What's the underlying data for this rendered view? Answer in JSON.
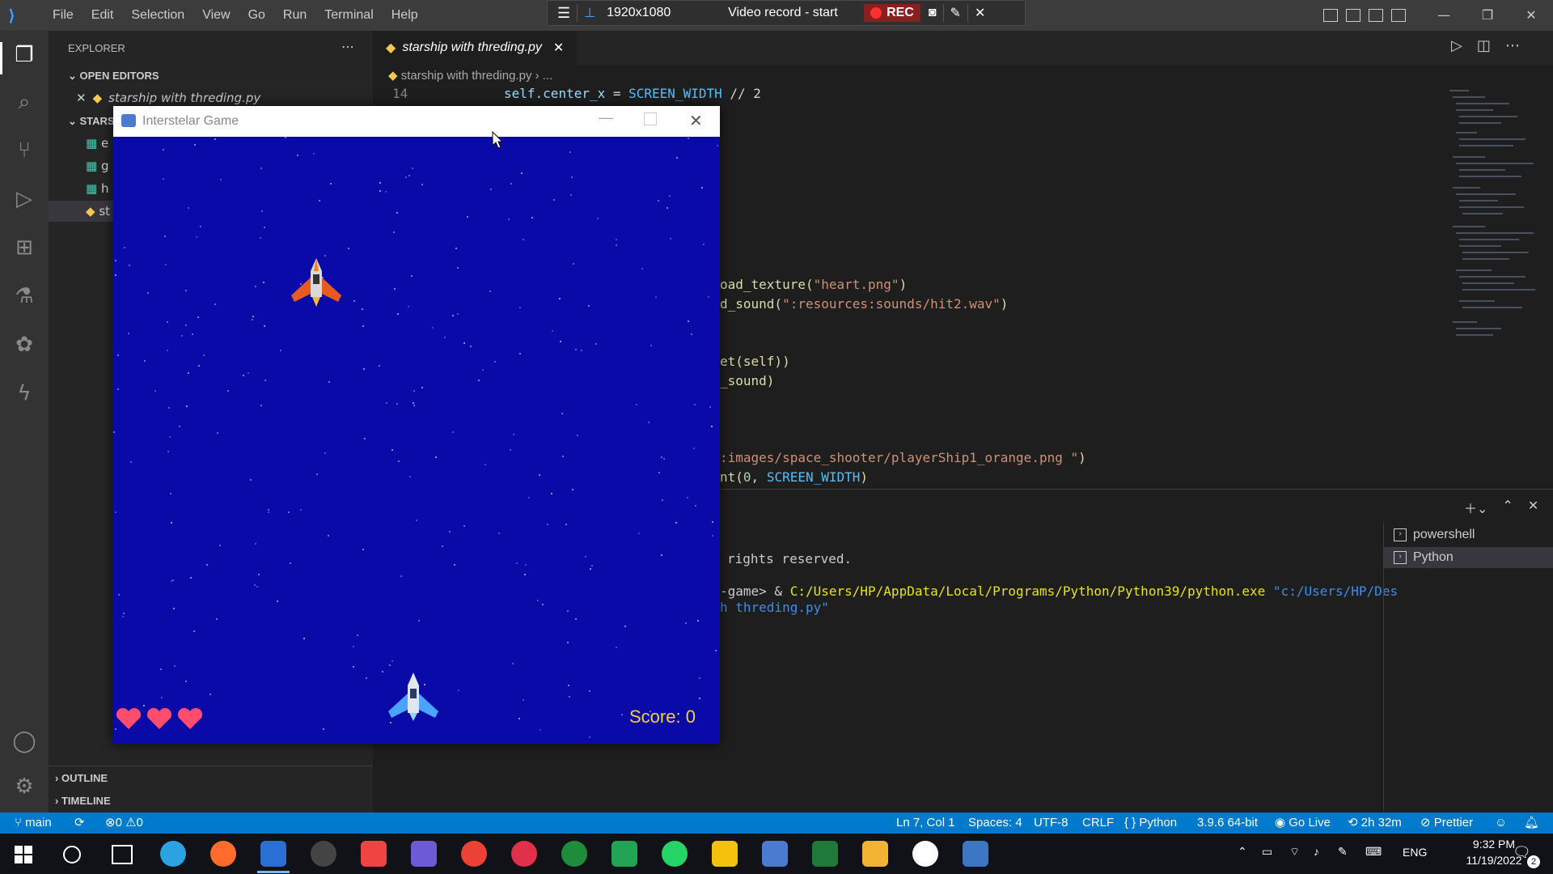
{
  "app": {
    "menu": [
      "File",
      "Edit",
      "Selection",
      "View",
      "Go",
      "Run",
      "Terminal",
      "Help"
    ],
    "window_controls": [
      "—",
      "❐",
      "✕"
    ]
  },
  "recorder": {
    "resolution": "1920x1080",
    "status": "Video record - start",
    "rec_label": "REC"
  },
  "sidebar": {
    "title": "EXPLORER",
    "open_editors": "OPEN EDITORS",
    "open_file": "starship with threding.py",
    "project": "STARSHI",
    "files": [
      "e",
      "g",
      "h",
      "st"
    ],
    "outline": "OUTLINE",
    "timeline": "TIMELINE"
  },
  "editor": {
    "tab": "starship with threding.py",
    "breadcrumb": "starship with threding.py",
    "breadcrumb_tail": "...",
    "line_number": "14",
    "code": {
      "l14_a": "self.",
      "l14_b": "center_x",
      "l14_c": " = ",
      "l14_d": "SCREEN_WIDTH",
      "l14_e": " // 2",
      "l_heart_a": "oad_texture(",
      "l_heart_b": "\"heart.png\"",
      "l_heart_c": ")",
      "l_sound_a": "d_sound(",
      "l_sound_b": "\":resources:sounds/hit2.wav\"",
      "l_sound_c": ")",
      "l_self": "et(self))",
      "l_snd": "_sound)",
      "l_img_a": ":images/space_shooter/playerShip1_orange.png \"",
      "l_img_b": ")",
      "l_rand_a": "nt(",
      "l_rand_b": "0",
      "l_rand_c": ", ",
      "l_rand_d": "SCREEN_WIDTH",
      "l_rand_e": ")"
    }
  },
  "terminal": {
    "rights": "rights reserved.",
    "prompt": "-game> & ",
    "exe": "C:/Users/HP/AppData/Local/Programs/Python/Python39/python.exe",
    "arg1": "\"c:/Users/HP/Des",
    "arg2": "h threding.py\"",
    "list": [
      "powershell",
      "Python"
    ]
  },
  "statusbar": {
    "branch": "main",
    "errors": "0",
    "warnings": "0",
    "cursor": "Ln 7, Col 1",
    "spaces": "Spaces: 4",
    "encoding": "UTF-8",
    "eol": "CRLF",
    "language": "Python",
    "interpreter": "3.9.6 64-bit",
    "golive": "Go Live",
    "time_spent": "2h 32m",
    "prettier": "Prettier"
  },
  "taskbar": {
    "lang": "ENG",
    "time": "9:32 PM",
    "date": "11/19/2022",
    "notifications": "2"
  },
  "game": {
    "title": "Interstelar Game",
    "score": "Score: 0",
    "lives": 3,
    "colors": {
      "background": "#0a0aa8",
      "score": "#f3d03e",
      "heart": "#ff4d6d"
    }
  }
}
